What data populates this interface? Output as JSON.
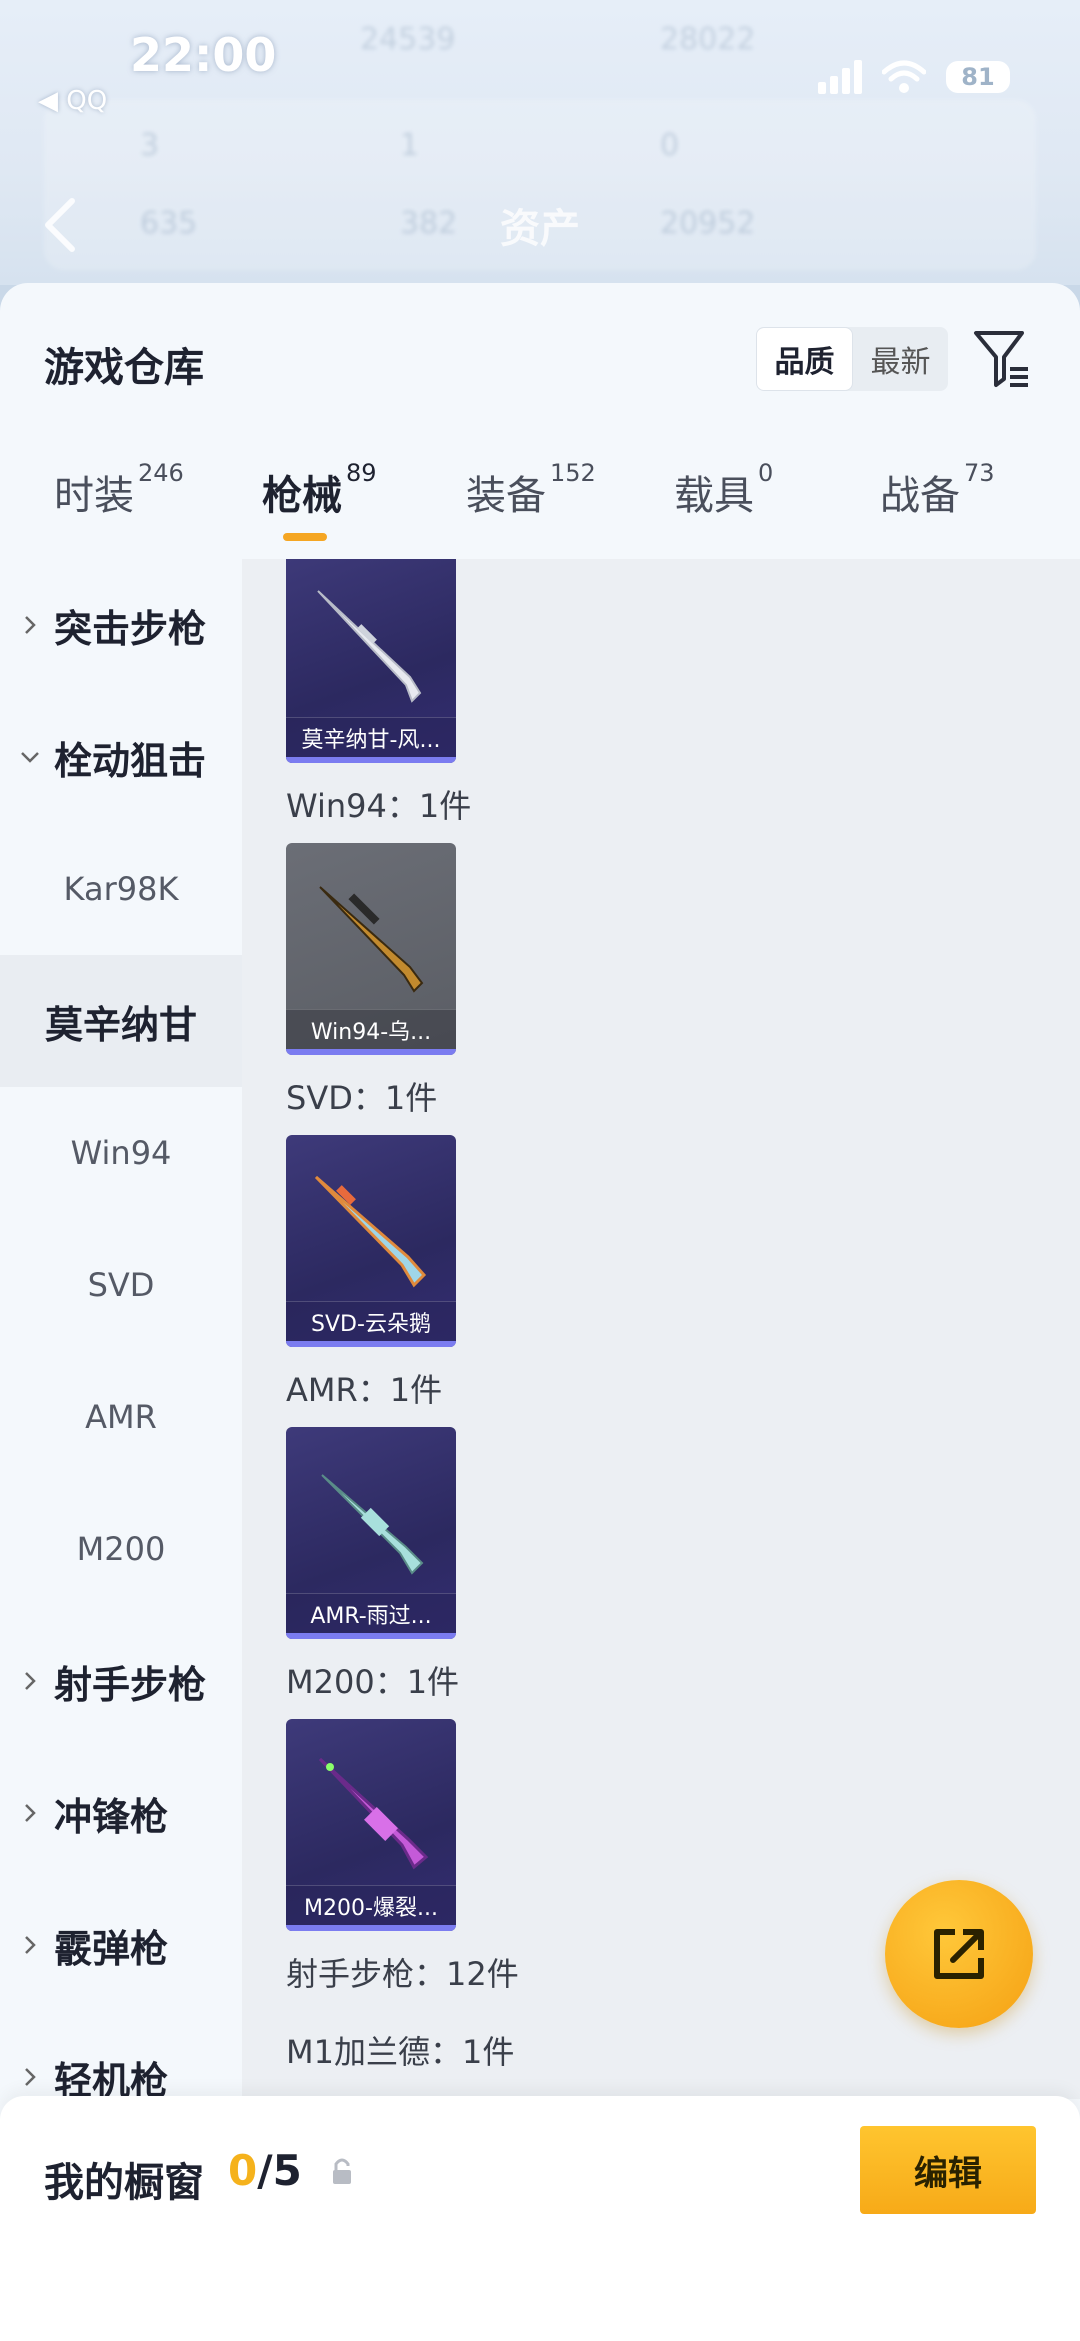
{
  "status_bar": {
    "time": "22:00",
    "back_app": "◀ QQ",
    "battery": "81"
  },
  "header": {
    "title": "资产",
    "ghost_stats": [
      "24539",
      "28022",
      "3",
      "1",
      "0",
      "635",
      "382",
      "20952"
    ]
  },
  "warehouse": {
    "title": "游戏仓库",
    "sort": {
      "quality": "品质",
      "latest": "最新"
    }
  },
  "tabs": [
    {
      "name": "时装",
      "count": "246"
    },
    {
      "name": "枪械",
      "count": "89"
    },
    {
      "name": "装备",
      "count": "152"
    },
    {
      "name": "载具",
      "count": "0"
    },
    {
      "name": "战备",
      "count": "73"
    }
  ],
  "categories": {
    "assault": "突击步枪",
    "bolt": "栓动狙击",
    "marksman": "射手步枪",
    "smg": "冲锋枪",
    "shotgun": "霰弹枪",
    "lmg": "轻机枪"
  },
  "subcategories": [
    "Kar98K",
    "莫辛纳甘",
    "Win94",
    "SVD",
    "AMR",
    "M200"
  ],
  "items": [
    {
      "label": "莫辛纳甘-风...",
      "count_line": "Win94：1件"
    },
    {
      "label": "Win94-乌...",
      "count_line": "SVD：1件"
    },
    {
      "label": "SVD-云朵鹅",
      "count_line": "AMR：1件"
    },
    {
      "label": "AMR-雨过...",
      "count_line": "M200：1件"
    },
    {
      "label": "M200-爆裂...",
      "count_line": "射手步枪：12件"
    }
  ],
  "extra_line": "M1加兰德：1件",
  "showcase": {
    "label": "我的橱窗",
    "current": "0",
    "total": "/5",
    "edit": "编辑"
  },
  "colors": {
    "accent": "#f5a623",
    "rarity_purple": "#7b7cf0",
    "card_purple": "#2c2960"
  },
  "icons": [
    "filter-icon",
    "chevron-right-icon",
    "chevron-down-icon",
    "share-icon",
    "lock-icon",
    "back-arrow-icon",
    "wifi-icon",
    "signal-icon"
  ]
}
